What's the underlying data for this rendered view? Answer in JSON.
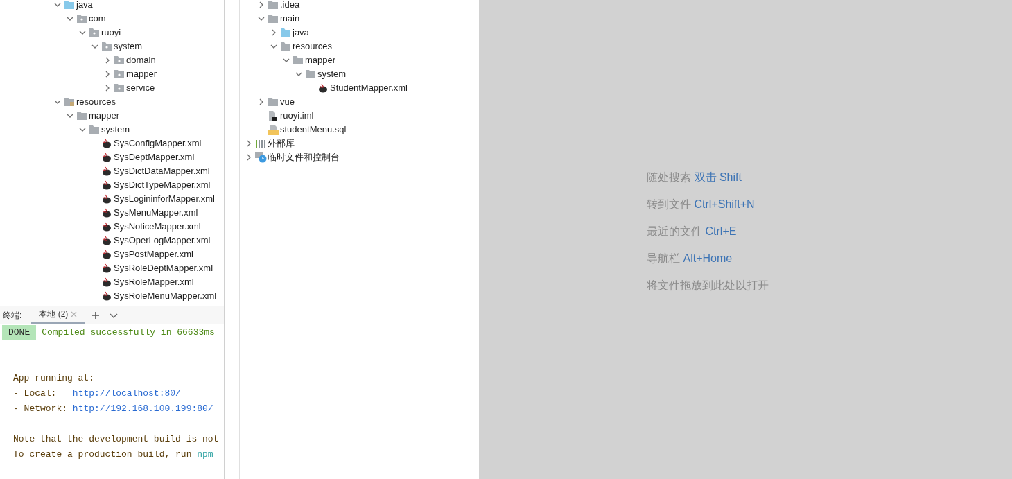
{
  "project_tree": {
    "items": [
      {
        "label": "java",
        "kind": "source_folder",
        "expanded": true,
        "children": [
          {
            "label": "com",
            "kind": "package",
            "expanded": true,
            "children": [
              {
                "label": "ruoyi",
                "kind": "package",
                "expanded": true,
                "children": [
                  {
                    "label": "system",
                    "kind": "package",
                    "expanded": true,
                    "children": [
                      {
                        "label": "domain",
                        "kind": "package",
                        "expanded": false
                      },
                      {
                        "label": "mapper",
                        "kind": "package",
                        "expanded": false
                      },
                      {
                        "label": "service",
                        "kind": "package",
                        "expanded": false
                      }
                    ]
                  }
                ]
              }
            ]
          }
        ]
      },
      {
        "label": "resources",
        "kind": "resource_folder",
        "expanded": true,
        "children": [
          {
            "label": "mapper",
            "kind": "folder",
            "expanded": true,
            "children": [
              {
                "label": "system",
                "kind": "folder",
                "expanded": true,
                "children": [
                  {
                    "label": "SysConfigMapper.xml",
                    "kind": "xml"
                  },
                  {
                    "label": "SysDeptMapper.xml",
                    "kind": "xml"
                  },
                  {
                    "label": "SysDictDataMapper.xml",
                    "kind": "xml"
                  },
                  {
                    "label": "SysDictTypeMapper.xml",
                    "kind": "xml"
                  },
                  {
                    "label": "SysLogininforMapper.xml",
                    "kind": "xml"
                  },
                  {
                    "label": "SysMenuMapper.xml",
                    "kind": "xml"
                  },
                  {
                    "label": "SysNoticeMapper.xml",
                    "kind": "xml"
                  },
                  {
                    "label": "SysOperLogMapper.xml",
                    "kind": "xml"
                  },
                  {
                    "label": "SysPostMapper.xml",
                    "kind": "xml"
                  },
                  {
                    "label": "SysRoleDeptMapper.xml",
                    "kind": "xml"
                  },
                  {
                    "label": "SysRoleMapper.xml",
                    "kind": "xml"
                  },
                  {
                    "label": "SysRoleMenuMapper.xml",
                    "kind": "xml"
                  }
                ]
              }
            ]
          }
        ]
      }
    ]
  },
  "terminal": {
    "label": "终端:",
    "tabs": [
      {
        "label": "本地 (2)",
        "selected": true
      }
    ],
    "lines": [
      {
        "badge": "DONE",
        "segments": [
          {
            "text": "Compiled successfully in 66633ms",
            "kind": "success"
          }
        ]
      },
      {
        "segments": [
          {
            "text": "App running at:",
            "kind": "plain"
          }
        ]
      },
      {
        "segments": [
          {
            "text": "- Local:   ",
            "kind": "plain"
          },
          {
            "text": "http://localhost:80/",
            "kind": "link"
          }
        ]
      },
      {
        "segments": [
          {
            "text": "- Network: ",
            "kind": "plain"
          },
          {
            "text": "http://192.168.100.199:80/",
            "kind": "link"
          }
        ]
      },
      {
        "segments": [
          {
            "text": "Note that the development build is not",
            "kind": "plain"
          }
        ]
      },
      {
        "segments": [
          {
            "text": "To create a production build, run ",
            "kind": "plain"
          },
          {
            "text": "npm",
            "kind": "command"
          }
        ]
      }
    ]
  },
  "second_tree": {
    "items": [
      {
        "label": ".idea",
        "kind": "folder",
        "expanded": false
      },
      {
        "label": "main",
        "kind": "folder",
        "expanded": true,
        "children": [
          {
            "label": "java",
            "kind": "source_folder",
            "expanded": false
          },
          {
            "label": "resources",
            "kind": "folder",
            "expanded": true,
            "children": [
              {
                "label": "mapper",
                "kind": "folder",
                "expanded": true,
                "children": [
                  {
                    "label": "system",
                    "kind": "folder",
                    "expanded": true,
                    "children": [
                      {
                        "label": "StudentMapper.xml",
                        "kind": "xml"
                      }
                    ]
                  }
                ]
              }
            ]
          }
        ]
      },
      {
        "label": "vue",
        "kind": "folder",
        "expanded": false
      },
      {
        "label": "ruoyi.iml",
        "kind": "iml"
      },
      {
        "label": "studentMenu.sql",
        "kind": "sql"
      }
    ],
    "root_items": [
      {
        "label": "外部库",
        "kind": "library",
        "expanded": false
      },
      {
        "label": "临时文件和控制台",
        "kind": "scratch",
        "expanded": false
      }
    ]
  },
  "editor_hints": [
    {
      "label": "随处搜索",
      "shortcut": "双击 Shift"
    },
    {
      "label": "转到文件",
      "shortcut": "Ctrl+Shift+N"
    },
    {
      "label": "最近的文件",
      "shortcut": "Ctrl+E"
    },
    {
      "label": "导航栏",
      "shortcut": "Alt+Home"
    },
    {
      "label": "将文件拖放到此处以打开"
    }
  ]
}
